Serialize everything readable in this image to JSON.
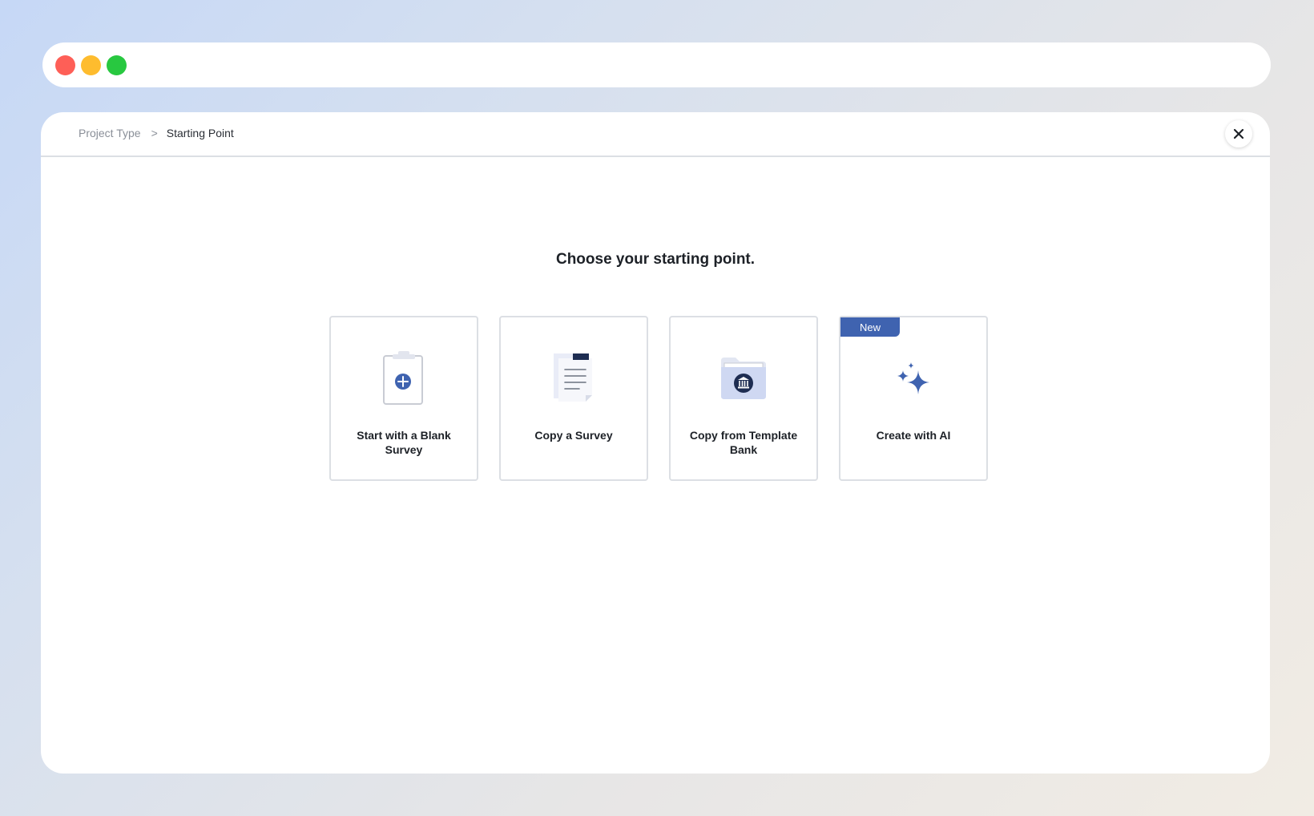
{
  "window": {
    "controls": [
      "close",
      "minimize",
      "maximize"
    ]
  },
  "breadcrumb": {
    "items": [
      {
        "label": "Project Type"
      },
      {
        "label": "Starting Point"
      }
    ],
    "separator": ">"
  },
  "header": {
    "close_icon": "close-icon"
  },
  "main": {
    "title": "Choose your starting point.",
    "cards": [
      {
        "label": "Start with a Blank Survey",
        "icon": "blank-survey-icon"
      },
      {
        "label": "Copy a Survey",
        "icon": "copy-document-icon"
      },
      {
        "label": "Copy from Template Bank",
        "icon": "template-folder-icon"
      },
      {
        "label": "Create with AI",
        "icon": "sparkles-icon",
        "badge": "New"
      }
    ]
  },
  "colors": {
    "accent": "#3f63b0",
    "accent_dark": "#1e2d52",
    "traffic_red": "#fe5f57",
    "traffic_yellow": "#febc2e",
    "traffic_green": "#28c840"
  }
}
